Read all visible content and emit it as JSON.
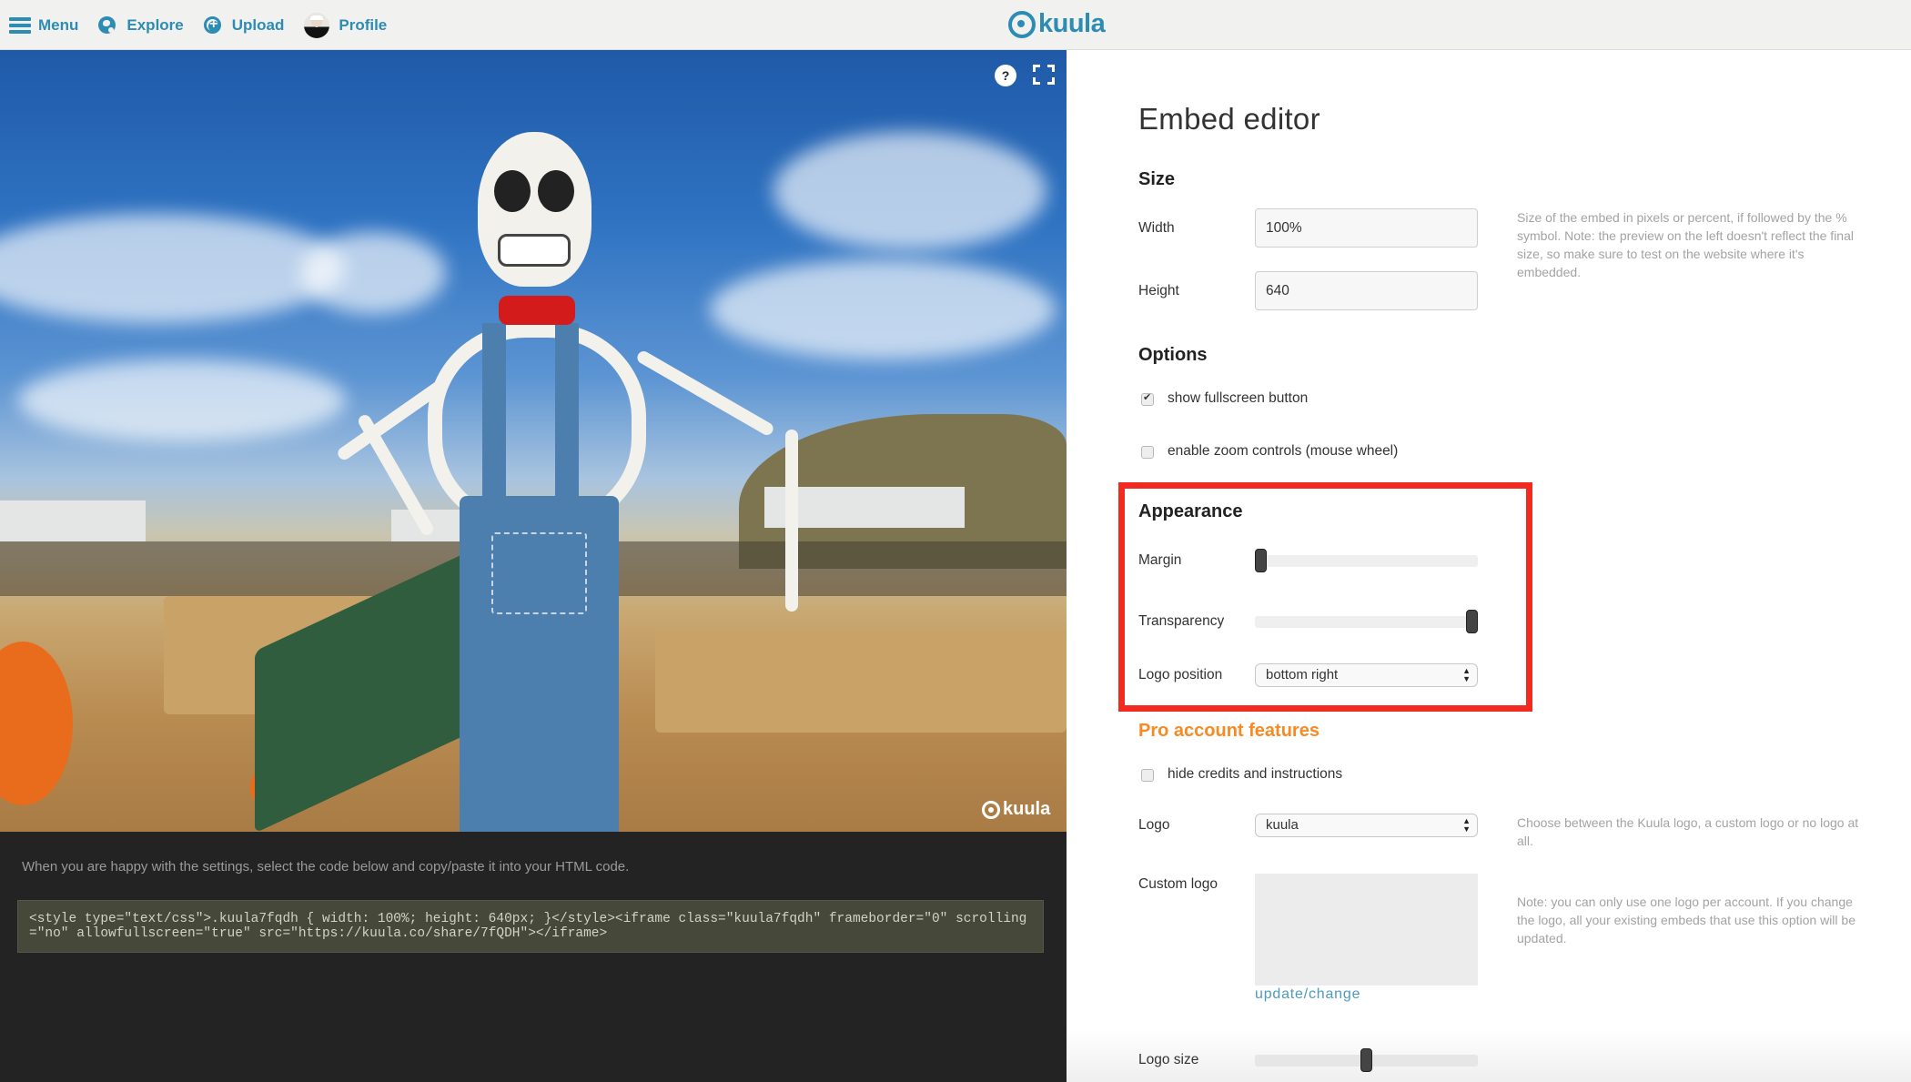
{
  "header": {
    "nav": [
      {
        "label": "Menu",
        "icon": "hamburger-icon"
      },
      {
        "label": "Explore",
        "icon": "globe-icon"
      },
      {
        "label": "Upload",
        "icon": "plus-circle-icon"
      },
      {
        "label": "Profile",
        "icon": "avatar"
      }
    ],
    "brand": "kuula",
    "accent_color": "#2d8cb3"
  },
  "viewer": {
    "help_label": "?",
    "watermark": "kuula",
    "instruction": "When you are happy with the settings, select the code below and copy/paste it into your HTML code.",
    "embed_code": "<style type=\"text/css\">.kuula7fqdh { width: 100%; height: 640px; }</style><iframe class=\"kuula7fqdh\" frameborder=\"0\" scrolling=\"no\" allowfullscreen=\"true\" src=\"https://kuula.co/share/7fQDH\"></iframe>"
  },
  "editor": {
    "title": "Embed editor",
    "size": {
      "heading": "Size",
      "width_label": "Width",
      "width_value": "100%",
      "height_label": "Height",
      "height_value": "640",
      "help": "Size of the embed in pixels or percent, if followed by the % symbol. Note: the preview on the left doesn't reflect the final size, so make sure to test on the website where it's embedded."
    },
    "options": {
      "heading": "Options",
      "items": [
        {
          "label": "show fullscreen button",
          "checked": true
        },
        {
          "label": "enable zoom controls (mouse wheel)",
          "checked": false
        }
      ]
    },
    "appearance": {
      "heading": "Appearance",
      "margin_label": "Margin",
      "margin_value": 0,
      "transparency_label": "Transparency",
      "transparency_value": 100,
      "logo_position_label": "Logo position",
      "logo_position_value": "bottom right",
      "highlight_color": "#f22a20"
    },
    "pro": {
      "heading": "Pro account features",
      "heading_color": "#f88a24",
      "hide_credits_label": "hide credits and instructions",
      "hide_credits_checked": false,
      "logo_label": "Logo",
      "logo_value": "kuula",
      "logo_help": "Choose between the Kuula logo, a custom logo or no logo at all.",
      "custom_logo_label": "Custom logo",
      "custom_logo_help": "Note: you can only use one logo per account. If you change the logo, all your existing embeds that use this option will be updated.",
      "update_link": "update/change",
      "logo_size_label": "Logo size",
      "logo_size_value": 50
    }
  }
}
